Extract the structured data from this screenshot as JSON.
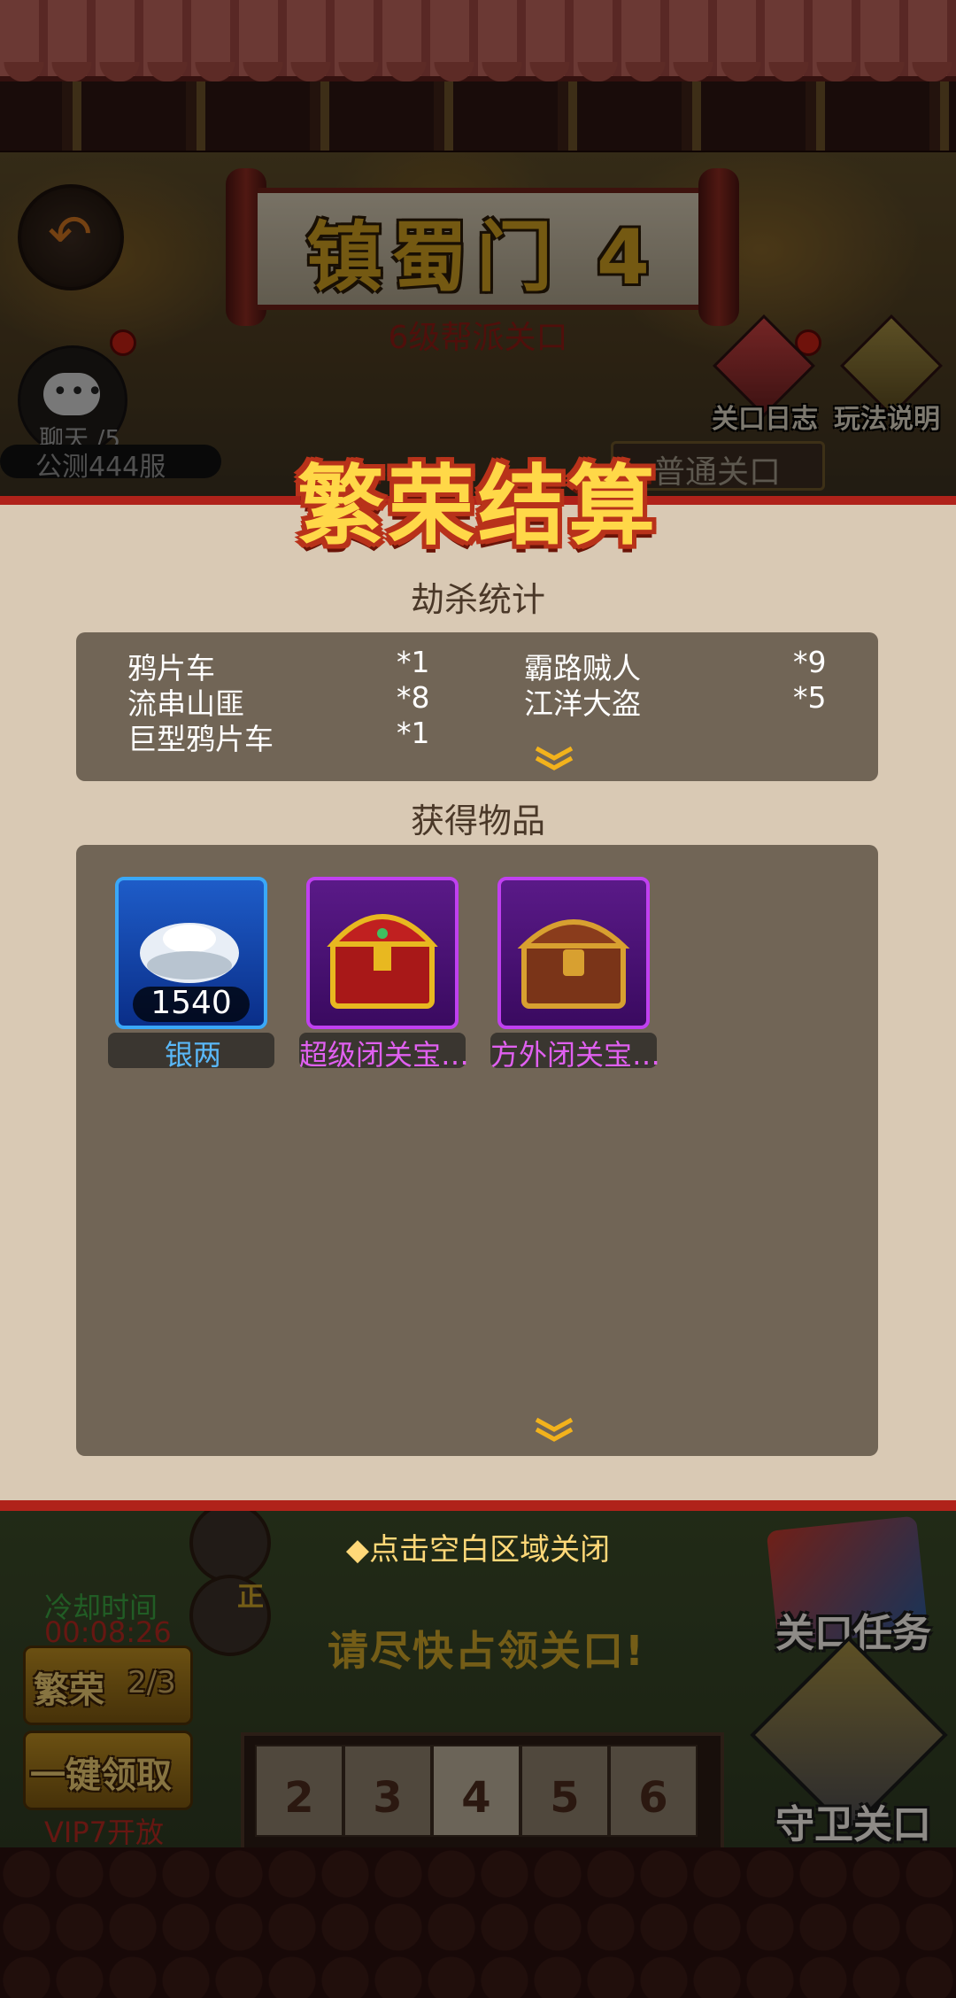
{
  "header": {
    "stage_title": "镇蜀门 4",
    "stage_subtitle": "6级帮派关口",
    "chat_label": "聊天 /5",
    "server_name": "公测444服",
    "stage_log_label": "关口日志",
    "rules_label": "玩法说明",
    "stage_type": "普通关口"
  },
  "panel": {
    "title": "繁荣结算",
    "kill_section_title": "劫杀统计",
    "kills": [
      {
        "name": "鸦片车",
        "count": "*1"
      },
      {
        "name": "霸路贼人",
        "count": "*9"
      },
      {
        "name": "流串山匪",
        "count": "*8"
      },
      {
        "name": "江洋大盗",
        "count": "*5"
      },
      {
        "name": "巨型鸦片车",
        "count": "*1"
      }
    ],
    "items_section_title": "获得物品",
    "items": [
      {
        "name": "银两",
        "quantity": "1540",
        "rarity": "blue",
        "icon": "silver-ingot-icon"
      },
      {
        "name": "超级闭关宝…",
        "quantity": "",
        "rarity": "purple",
        "icon": "red-gold-chest-icon"
      },
      {
        "name": "方外闭关宝…",
        "quantity": "",
        "rarity": "purple",
        "icon": "wooden-chest-icon"
      }
    ],
    "expand_icon": "double-chevron-down-icon"
  },
  "footer": {
    "close_hint": "◆点击空白区域关闭",
    "cooldown_label": "冷却时间",
    "cooldown_time": "00:08:26",
    "prosperity_label": "繁荣",
    "prosperity_count": "2/3",
    "claim_all_label": "一键领取",
    "vip_note": "VIP7开放",
    "urge_text": "请尽快占领关口!",
    "slots": [
      "2",
      "3",
      "4",
      "5",
      "6"
    ],
    "mission_label": "关口任务",
    "guard_label": "守卫关口",
    "avatar_badge": "正"
  },
  "colors": {
    "panel_bg": "#d9c9b4",
    "box_bg": "#716556",
    "accent_red": "#b0221a",
    "title_yellow": "#ffd848",
    "hint_yellow": "#ffd878"
  }
}
